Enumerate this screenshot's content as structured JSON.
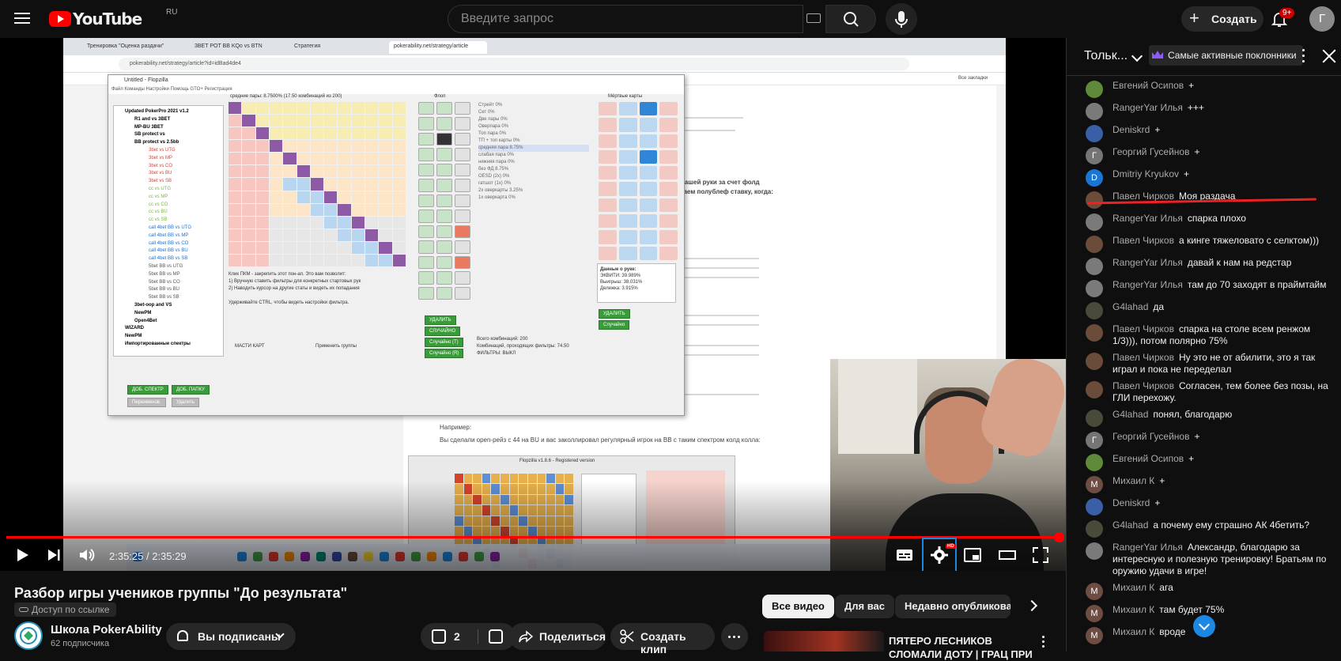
{
  "header": {
    "logo_text": "YouTube",
    "region": "RU",
    "search_placeholder": "Введите запрос",
    "create_label": "Создать",
    "notifications_count": "9+",
    "user_initial": "Г"
  },
  "player": {
    "time_display": "2:35:25 / 2:35:29",
    "progress_fraction": 0.9996,
    "hd_badge": "HD",
    "screen": {
      "tabs": [
        "Тренировка \"Оценка раздачи\"",
        "3BET POT BB KQo vs BTN",
        "Стратегия",
        "pokerability.net/strategy/article"
      ],
      "address": "pokerability.net/strategy/article?id=idBad4de4",
      "bookmarks_right": "Все закладки",
      "flopzilla_title": "Untitled - Flopzilla",
      "flopzilla_menu": "Файл   Команды   Настройки   Помощь   GTO+   Регистрация",
      "range_header": "средние пары: 8.7500%   (17.50 комбинаций из 200)",
      "tree": [
        "Updated PokerPro 2021 v1.2",
        "R1 and vs 3BET",
        "MP-BU 3BET",
        "SB protect vs",
        "BB protect vs 2.5bb",
        "3bet vs UTG",
        "3bet vs MP",
        "3bet vs CO",
        "3bet vs BU",
        "3bet vs SB",
        "cc vs UTG",
        "cc vs MP",
        "cc vs CO",
        "cc vs BU",
        "cc vs SB",
        "call 4bet BB vs UTG",
        "call 4bet BB vs MP",
        "call 4bet BB vs CO",
        "call 4bet BB vs BU",
        "call 4bet BB vs SB",
        "5bet BB vs UTG",
        "5bet BB vs MP",
        "5bet BB vs CO",
        "5bet BB vs BU",
        "5bet BB vs SB",
        "3bet-oop and VS",
        "NewPM",
        "Open4Bet",
        "WIZARD",
        "NewPM",
        "Импортированные спектры"
      ],
      "note": "Клик ПКМ - закрепить этот пон-ап. Это вам позволит:\n1) Вручную ставить фильтры для конкретных стартовых рук\n2) Наводить курсор на другие статы и видеть их попадания\n\nУдерживайте CTRL, чтобы видеть настройки фильтра.",
      "buttons": {
        "add_spectrum": "ДОБ. СПЕКТР",
        "add_folder": "ДОБ. ПАПКУ",
        "rename": "Переименов.",
        "delete": "Удалить",
        "suits": "МАСТИ КАРТ",
        "apply_groups": "Применить группы",
        "remove": "УДАЛИТЬ",
        "random": "СЛУЧАЙНО",
        "random_t": "Случайно (T)",
        "random_r": "Случайно (R)",
        "remove2": "УДАЛИТЬ",
        "random2": "Случайно"
      },
      "flop_label": "Флоп",
      "dead_cards_label": "Мёртвые карты",
      "stats": [
        "Стрейт  0%",
        "Сет  0%",
        "Две пары  0%",
        "Оверпара  0%",
        "Топ пара  0%",
        "ТП + топ карты  0%",
        "средняя пара  8.75%",
        "слабая пара  0%",
        "нижняя пара  0%",
        "без ФД  8.75%",
        "OESD (2x)  0%",
        "гатшот (1x)  0%",
        "2x оверкарты  3.25%",
        "1x оверкарта  0%"
      ],
      "combos": "Всего комбинаций: 200",
      "combos_filter": "Комбинаций, проходящих фильтры: 74.50",
      "filters": "ФИЛЬТРЫ: ВЫКЛ",
      "hand_data_title": "Данные о руке:",
      "hand_data": [
        "ЭКВИТИ: 39.989%",
        "Выигрыш: 38.031%",
        "Дележка: 3.915%"
      ],
      "article_lines": [
        "ти нашей руки за счет фолд",
        "делаем полублеф ставку, когда:",
        "Например:",
        "Вы сделали open-рейз с 44 на BU и вас заколлировал регулярный игрок на BB с таким спектром колд колла:",
        "Flopzilla v1.8.6 - Registered version"
      ]
    }
  },
  "chat": {
    "title": "Тольк...",
    "filter_chip": "Самые активные поклонники",
    "messages": [
      {
        "author": "Евгений Осипов",
        "text": "+",
        "color": "#5f8a3a",
        "initial": ""
      },
      {
        "author": "RangerYar Илья",
        "text": "+++",
        "color": "#7a7a7a",
        "initial": ""
      },
      {
        "author": "Deniskrd",
        "text": "+",
        "color": "#3a5fa6",
        "initial": ""
      },
      {
        "author": "Георгий Гусейнов",
        "text": "+",
        "color": "#757575",
        "initial": "Г"
      },
      {
        "author": "Dmitriy Kryukov",
        "text": "+",
        "color": "#1976d2",
        "initial": "D"
      },
      {
        "author": "Павел Чирков",
        "text": "Моя раздача",
        "color": "#6b4b3a",
        "initial": ""
      },
      {
        "author": "RangerYar Илья",
        "text": "спарка плохо",
        "color": "#7a7a7a",
        "initial": ""
      },
      {
        "author": "Павел Чирков",
        "text": "а кинге тяжеловато с селктом)))",
        "color": "#6b4b3a",
        "initial": ""
      },
      {
        "author": "RangerYar Илья",
        "text": "давай к нам на редстар",
        "color": "#7a7a7a",
        "initial": ""
      },
      {
        "author": "RangerYar Илья",
        "text": "там до 70 заходят в праймтайм",
        "color": "#7a7a7a",
        "initial": ""
      },
      {
        "author": "G4lahad",
        "text": "да",
        "color": "#4a4a3a",
        "initial": ""
      },
      {
        "author": "Павел Чирков",
        "text": "спарка на столе всем ренжом 1/3))), потом полярно 75%",
        "color": "#6b4b3a",
        "initial": ""
      },
      {
        "author": "Павел Чирков",
        "text": "Ну это не от абилити, это я так играл и пока не переделал",
        "color": "#6b4b3a",
        "initial": ""
      },
      {
        "author": "Павел Чирков",
        "text": "Согласен, тем более без позы, на ГЛИ перехожу.",
        "color": "#6b4b3a",
        "initial": ""
      },
      {
        "author": "G4lahad",
        "text": "понял, благодарю",
        "color": "#4a4a3a",
        "initial": ""
      },
      {
        "author": "Георгий Гусейнов",
        "text": "+",
        "color": "#757575",
        "initial": "Г"
      },
      {
        "author": "Евгений Осипов",
        "text": "+",
        "color": "#5f8a3a",
        "initial": ""
      },
      {
        "author": "Михаил К",
        "text": "+",
        "color": "#6d4c41",
        "initial": "М"
      },
      {
        "author": "Deniskrd",
        "text": "+",
        "color": "#3a5fa6",
        "initial": ""
      },
      {
        "author": "G4lahad",
        "text": "а почему ему страшно АК 4бетить?",
        "color": "#4a4a3a",
        "initial": ""
      },
      {
        "author": "RangerYar Илья",
        "text": "Александр, благодарю за интересную и полезную тренировку! Братьям по оружию удачи в игре!",
        "color": "#7a7a7a",
        "initial": ""
      },
      {
        "author": "Михаил К",
        "text": "ага",
        "color": "#6d4c41",
        "initial": "М"
      },
      {
        "author": "Михаил К",
        "text": "там будет 75%",
        "color": "#6d4c41",
        "initial": "М"
      },
      {
        "author": "Михаил К",
        "text": "вроде",
        "color": "#6d4c41",
        "initial": "М"
      }
    ]
  },
  "video": {
    "title": "Разбор игры учеников группы \"До результата\"",
    "visibility": "Доступ по ссылке",
    "channel_name": "Школа PokerAbility",
    "subscribers": "62 подписчика",
    "subscribed_label": "Вы подписаны",
    "likes": "2",
    "share_label": "Поделиться",
    "clip_label": "Создать клип"
  },
  "recommendations": {
    "chips": [
      "Все видео",
      "Для вас",
      "Недавно опубликованн"
    ],
    "first_title": "ПЯТЕРО ЛЕСНИКОВ",
    "first_title_line2": "СЛОМАЛИ ДОТУ | ГРАЦ ПРИ"
  },
  "colors": {
    "accent": "#ff0000",
    "background": "#0f0f0f",
    "chip_bg": "#272727",
    "link_blue": "#1d87e4"
  }
}
